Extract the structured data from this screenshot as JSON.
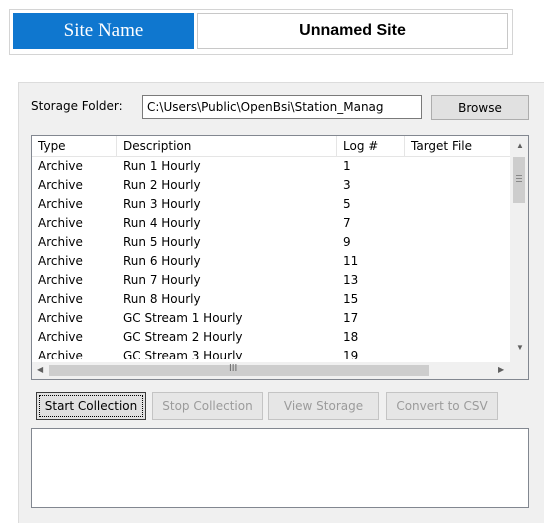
{
  "site": {
    "label": "Site Name",
    "value": "Unnamed Site"
  },
  "storage": {
    "label": "Storage Folder:",
    "path": "C:\\Users\\Public\\OpenBsi\\Station_Manag",
    "browse_label": "Browse"
  },
  "list": {
    "columns": [
      "Type",
      "Description",
      "Log #",
      "Target File"
    ],
    "rows": [
      {
        "type": "Archive",
        "description": "Run 1 Hourly",
        "log": "1"
      },
      {
        "type": "Archive",
        "description": "Run 2 Hourly",
        "log": "3"
      },
      {
        "type": "Archive",
        "description": "Run 3 Hourly",
        "log": "5"
      },
      {
        "type": "Archive",
        "description": "Run 4 Hourly",
        "log": "7"
      },
      {
        "type": "Archive",
        "description": "Run 5 Hourly",
        "log": "9"
      },
      {
        "type": "Archive",
        "description": "Run 6 Hourly",
        "log": "11"
      },
      {
        "type": "Archive",
        "description": "Run 7 Hourly",
        "log": "13"
      },
      {
        "type": "Archive",
        "description": "Run 8 Hourly",
        "log": "15"
      },
      {
        "type": "Archive",
        "description": "GC Stream 1 Hourly",
        "log": "17"
      },
      {
        "type": "Archive",
        "description": "GC Stream 2 Hourly",
        "log": "18"
      },
      {
        "type": "Archive",
        "description": "GC Stream 3 Hourly",
        "log": "19"
      }
    ],
    "hscroll_grip": "III"
  },
  "actions": {
    "start": "Start Collection",
    "stop": "Stop Collection",
    "view": "View Storage",
    "convert": "Convert to CSV"
  },
  "colors": {
    "accent": "#0f77cf"
  },
  "icons": {
    "scroll_up": "scroll-up-arrow-icon",
    "scroll_down": "scroll-down-arrow-icon",
    "scroll_left": "scroll-left-arrow-icon",
    "scroll_right": "scroll-right-arrow-icon"
  }
}
